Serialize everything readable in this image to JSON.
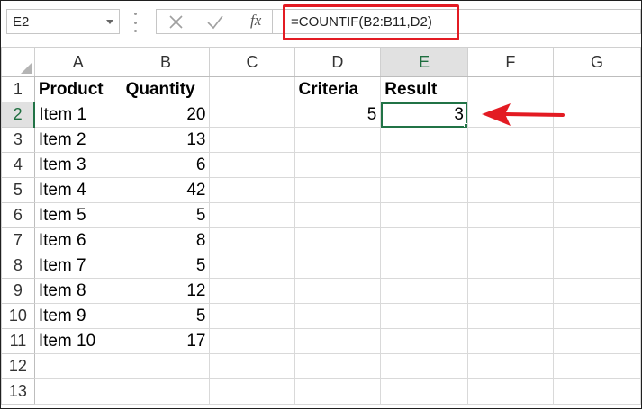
{
  "name_box": {
    "value": "E2"
  },
  "formula_bar": {
    "cancel_icon": "close-icon",
    "enter_icon": "check-icon",
    "fx_label": "fx",
    "formula": "=COUNTIF(B2:B11,D2)"
  },
  "sheet": {
    "columns": [
      "A",
      "B",
      "C",
      "D",
      "E",
      "F",
      "G"
    ],
    "selected_column": "E",
    "selected_row": 2,
    "active_cell": "E2",
    "row_numbers": [
      "1",
      "2",
      "3",
      "4",
      "5",
      "6",
      "7",
      "8",
      "9",
      "10",
      "11",
      "12",
      "13"
    ],
    "headers": {
      "A1": "Product",
      "B1": "Quantity",
      "D1": "Criteria",
      "E1": "Result"
    },
    "rows": [
      {
        "product": "Item 1",
        "quantity": "20",
        "criteria": "5",
        "result": "3"
      },
      {
        "product": "Item 2",
        "quantity": "13"
      },
      {
        "product": "Item 3",
        "quantity": "6"
      },
      {
        "product": "Item 4",
        "quantity": "42"
      },
      {
        "product": "Item 5",
        "quantity": "5"
      },
      {
        "product": "Item 6",
        "quantity": "8"
      },
      {
        "product": "Item 7",
        "quantity": "5"
      },
      {
        "product": "Item 8",
        "quantity": "12"
      },
      {
        "product": "Item 9",
        "quantity": "5"
      },
      {
        "product": "Item 10",
        "quantity": "17"
      }
    ]
  },
  "annotations": {
    "highlight_color": "#e31b23",
    "arrow_color": "#e31b23",
    "selection_color": "#217346"
  }
}
